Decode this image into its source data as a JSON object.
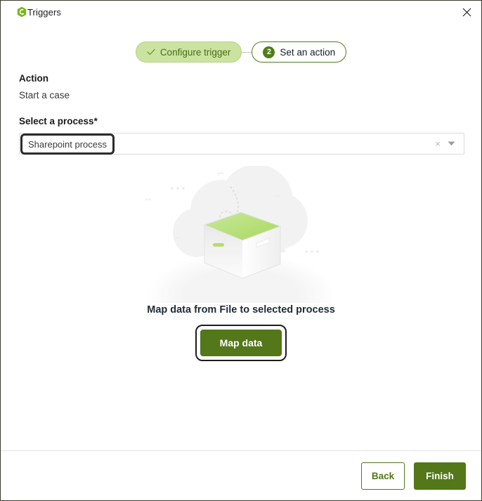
{
  "window": {
    "title": "Triggers",
    "logo_icon": "flowable-hexagon-logo",
    "close_icon": "close-icon"
  },
  "stepper": {
    "steps": [
      {
        "label": "Configure trigger",
        "state": "completed",
        "icon": "check-icon",
        "number": ""
      },
      {
        "label": "Set an action",
        "state": "current",
        "icon": "",
        "number": "2"
      }
    ]
  },
  "form": {
    "action_heading": "Action",
    "action_value": "Start a case",
    "process_label": "Select a process",
    "process_required_mark": "*",
    "process_value": "Sharepoint process",
    "clear_icon": "clear-x-icon",
    "caret_icon": "chevron-down-icon"
  },
  "empty_state": {
    "illustration_icon": "empty-box-cloud-illustration",
    "title": "Map data from File to selected process",
    "button_label": "Map data"
  },
  "footer": {
    "back_label": "Back",
    "finish_label": "Finish"
  },
  "colors": {
    "primary_green": "#537719",
    "pill_done_bg": "#cbe3a0",
    "pill_done_text": "#4a6b18",
    "step_circle": "#4f7d1c",
    "illustration_gray": "#f2f2f2",
    "illustration_green": "#b5dd6e"
  }
}
